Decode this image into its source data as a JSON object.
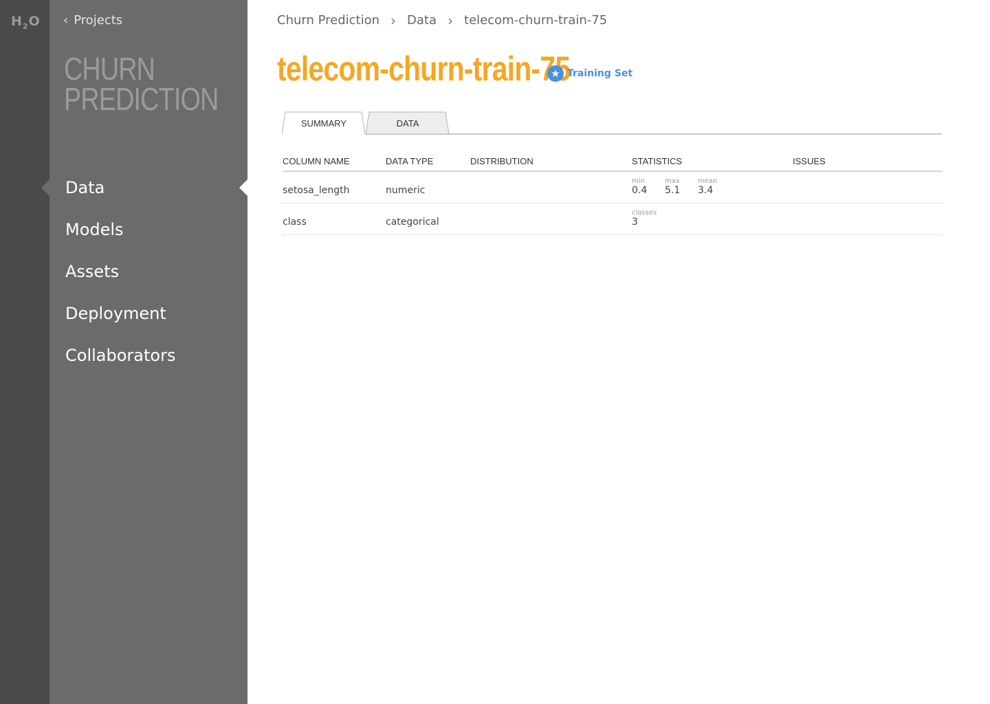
{
  "app": {
    "logo": "H",
    "logo_sub": "2",
    "logo_tail": "O"
  },
  "sidebar": {
    "back_label": "Projects",
    "project_title": "CHURN PREDICTION",
    "items": [
      {
        "label": "Data",
        "active": true
      },
      {
        "label": "Models"
      },
      {
        "label": "Assets"
      },
      {
        "label": "Deployment"
      },
      {
        "label": "Collaborators"
      }
    ]
  },
  "breadcrumb": [
    "Churn Prediction",
    "Data",
    "telecom-churn-train-75"
  ],
  "page": {
    "title": "telecom-churn-train-75",
    "badge_label": "Training Set",
    "badge_icon": "star-icon",
    "accent_color": "#f5a623",
    "badge_color": "#4a90e2"
  },
  "tabs": [
    {
      "label": "SUMMARY",
      "active": true
    },
    {
      "label": "DATA",
      "active": false
    }
  ],
  "table": {
    "headers": [
      "COLUMN NAME",
      "DATA TYPE",
      "DISTRIBUTION",
      "STATISTICS",
      "ISSUES"
    ],
    "rows": [
      {
        "name": "setosa_length",
        "type": "numeric",
        "stats": [
          {
            "label": "min",
            "value": "0.4"
          },
          {
            "label": "max",
            "value": "5.1"
          },
          {
            "label": "mean",
            "value": "3.4"
          }
        ]
      },
      {
        "name": "class",
        "type": "categorical",
        "stats": [
          {
            "label": "classes",
            "value": "3"
          }
        ]
      }
    ]
  }
}
